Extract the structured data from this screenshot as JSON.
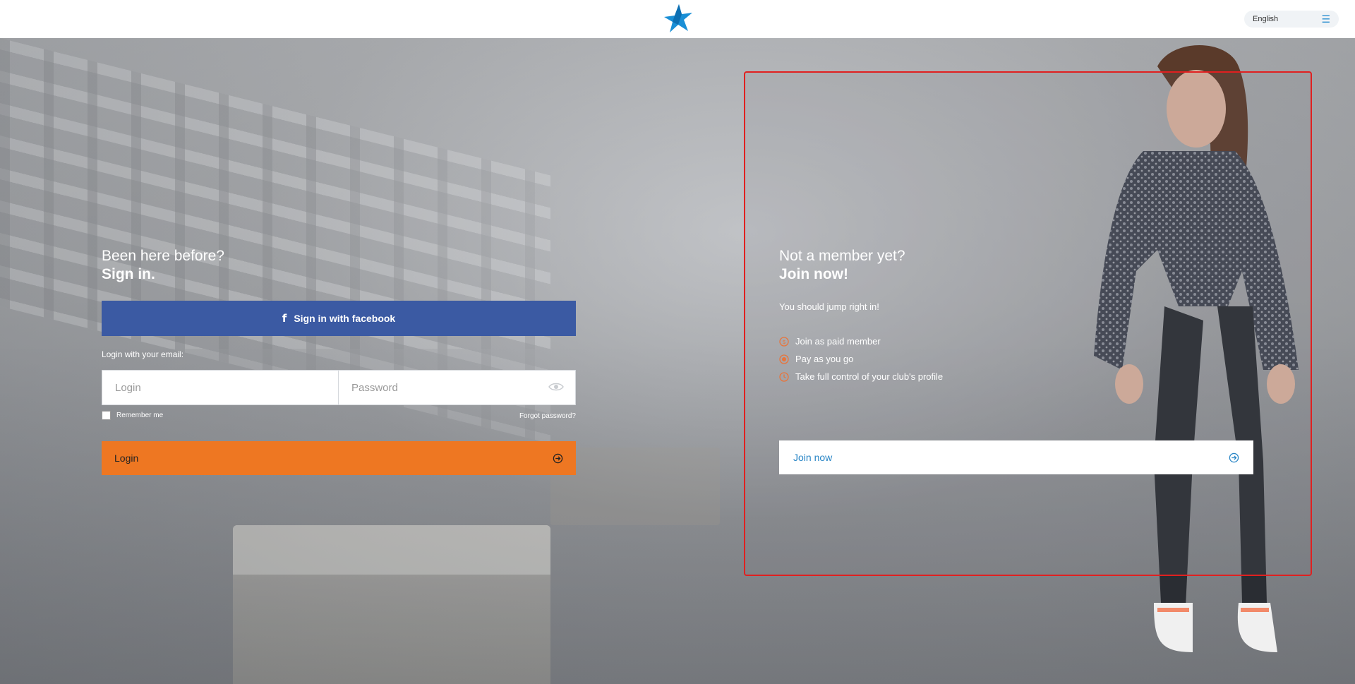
{
  "header": {
    "logo_icon": "star-logo-icon",
    "language": "English",
    "menu_icon": "hamburger-menu-icon",
    "accent_color": "#2a8fd0"
  },
  "login": {
    "heading_line1": "Been here before?",
    "heading_line2": "Sign in.",
    "facebook_button": "Sign in with facebook",
    "facebook_color": "#3b5aa3",
    "email_label": "Login with your email:",
    "login_placeholder": "Login",
    "password_placeholder": "Password",
    "remember_label": "Remember me",
    "remember_checked": false,
    "forgot_link": "Forgot password?",
    "login_button": "Login",
    "login_button_color": "#ee7722"
  },
  "join": {
    "heading_line1": "Not a member yet?",
    "heading_line2": "Join now!",
    "subtitle": "You should jump right in!",
    "benefits": [
      {
        "label": "Join as paid member",
        "icon": "membership-icon"
      },
      {
        "label": "Pay as you go",
        "icon": "target-icon"
      },
      {
        "label": "Take full control of your club's profile",
        "icon": "clock-icon"
      }
    ],
    "join_button": "Join now",
    "join_button_text_color": "#2a86c6",
    "icon_color": "#e8743b",
    "frame_color": "#e02020"
  }
}
